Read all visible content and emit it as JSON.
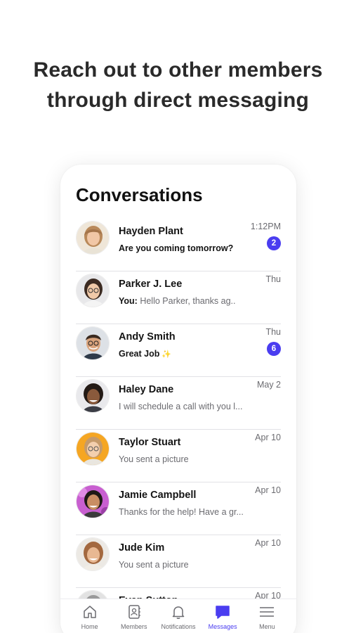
{
  "headline": {
    "line1": "Reach out to other members",
    "line2": "through direct messaging"
  },
  "screen": {
    "title": "Conversations"
  },
  "conversations": [
    {
      "name": "Hayden Plant",
      "preview": "Are you coming tomorrow?",
      "time": "1:12PM",
      "badge": "2",
      "unread": true
    },
    {
      "name": "Parker J. Lee",
      "you": "You:",
      "preview": " Hello Parker, thanks ag..",
      "time": "Thu"
    },
    {
      "name": "Andy Smith",
      "preview": "Great Job",
      "emoji": "✨",
      "time": "Thu",
      "badge": "6",
      "unread": true
    },
    {
      "name": "Haley Dane",
      "preview": "I will schedule a call with you l...",
      "time": "May 2"
    },
    {
      "name": "Taylor Stuart",
      "preview": "You sent a picture",
      "time": "Apr 10"
    },
    {
      "name": "Jamie Campbell",
      "preview": "Thanks for the help! Have a gr...",
      "time": "Apr 10"
    },
    {
      "name": "Jude Kim",
      "preview": "You sent a picture",
      "time": "Apr 10"
    },
    {
      "name": "Evan Sutton",
      "time": "Apr 10"
    }
  ],
  "tabbar": {
    "items": [
      {
        "label": "Home",
        "icon": "home-icon"
      },
      {
        "label": "Members",
        "icon": "members-icon"
      },
      {
        "label": "Notifications",
        "icon": "bell-icon"
      },
      {
        "label": "Messages",
        "icon": "chat-icon",
        "active": true
      },
      {
        "label": "Menu",
        "icon": "menu-icon"
      }
    ]
  },
  "colors": {
    "accent": "#4a3df0",
    "text": "#141414",
    "muted": "#6b6b70"
  }
}
